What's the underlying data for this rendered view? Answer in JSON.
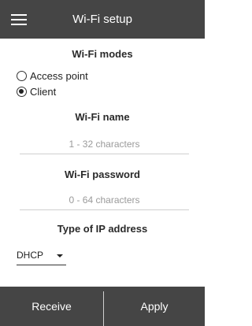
{
  "header": {
    "title": "Wi-Fi setup",
    "menu_icon": "hamburger-menu-icon"
  },
  "wifi_modes": {
    "title": "Wi-Fi modes",
    "options": [
      {
        "label": "Access point",
        "selected": false
      },
      {
        "label": "Client",
        "selected": true
      }
    ]
  },
  "wifi_name": {
    "title": "Wi-Fi name",
    "value": "",
    "placeholder": "1 - 32 characters"
  },
  "wifi_password": {
    "title": "Wi-Fi password",
    "value": "",
    "placeholder": "0 - 64 characters"
  },
  "ip_type": {
    "title": "Type of IP address",
    "selected": "DHCP"
  },
  "footer": {
    "receive_label": "Receive",
    "apply_label": "Apply"
  },
  "colors": {
    "bar_background": "#454545",
    "text_on_bar": "#ffffff"
  }
}
